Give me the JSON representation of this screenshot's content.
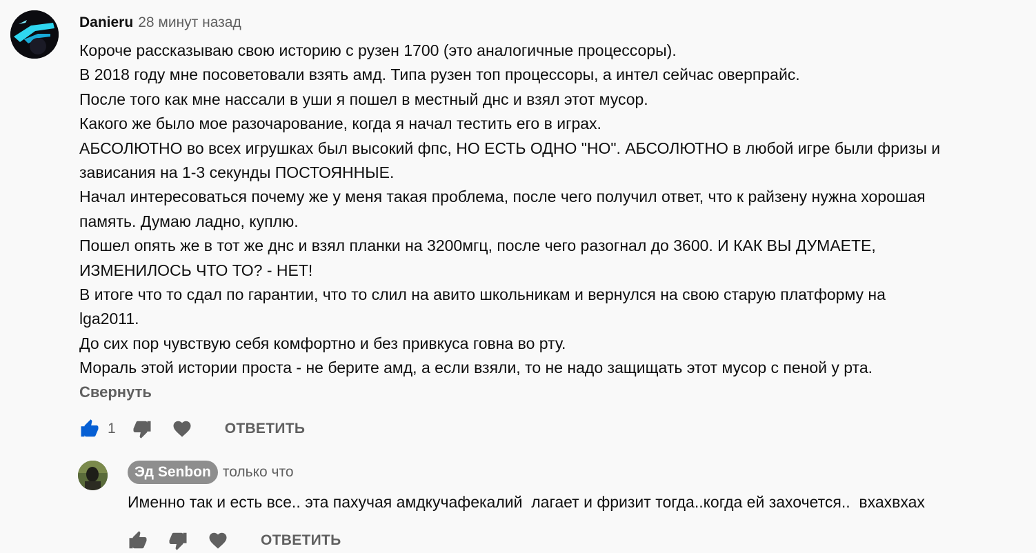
{
  "comment": {
    "author": "Danieru",
    "timestamp": "28 минут назад",
    "lines": [
      "Короче рассказываю свою историю с рузен 1700 (это аналогичные процессоры).",
      "В 2018 году мне посоветовали взять амд. Типа рузен топ процессоры, а интел сейчас оверпрайс.",
      "После того как мне нассали в уши я пошел в местный днс и взял этот мусор.",
      "Какого же было мое разочарование, когда я начал тестить его в играх.",
      "АБСОЛЮТНО во всех игрушках был высокий фпс, НО ЕСТЬ ОДНО \"НО\". АБСОЛЮТНО в любой игре были фризы и",
      "зависания на 1-3 секунды ПОСТОЯННЫЕ.",
      "Начал интересоваться почему же у меня такая проблема, после чего получил ответ, что к райзену нужна хорошая",
      "память. Думаю ладно, куплю.",
      "Пошел опять же в тот же днс и взял планки на 3200мгц, после чего разогнал до 3600. И КАК ВЫ ДУМАЕТЕ,",
      "ИЗМЕНИЛОСЬ ЧТО ТО? - НЕТ!",
      "В итоге что то сдал по гарантии, что то слил на авито школьникам и вернулся на свою старую платформу на",
      "lga2011.",
      "До сих пор чувствую себя комфортно и без привкуса говна во рту.",
      "Мораль этой истории проста - не берите амд, а если взяли, то не надо защищать этот мусор с пеной у рта."
    ],
    "collapse_label": "Свернуть",
    "like_count": "1",
    "like_active": true,
    "reply_label": "ОТВЕТИТЬ"
  },
  "reply": {
    "author": "Эд Senbon",
    "timestamp": "только что",
    "text": "Именно так и есть все.. эта пахучая амдкучафекалий  лагает и фризит тогда..когда ей захочется..  вхахвхах",
    "reply_label": "ОТВЕТИТЬ"
  },
  "colors": {
    "like_active": "#065fd4",
    "icon_inactive": "#606060",
    "chip_bg": "#8e8e8e"
  }
}
